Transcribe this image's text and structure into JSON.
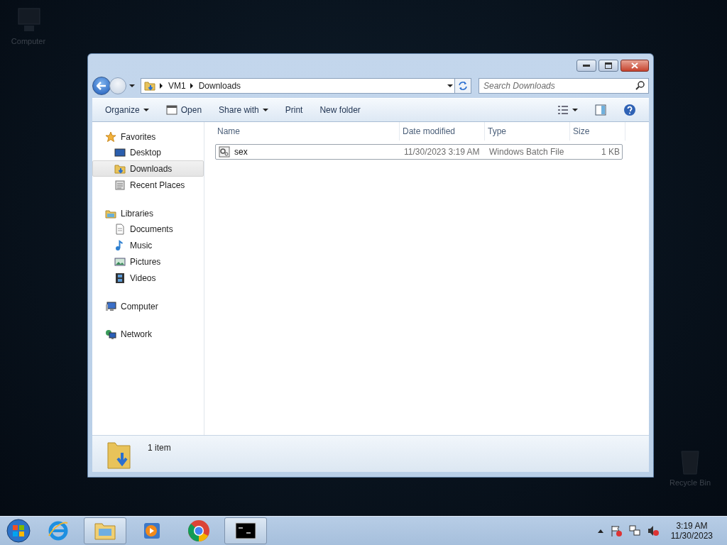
{
  "desktop": {
    "icons": [
      {
        "label": "Computer"
      },
      {
        "label": "Recycle Bin"
      }
    ]
  },
  "window": {
    "address": {
      "path": [
        "VM1",
        "Downloads"
      ]
    },
    "search": {
      "placeholder": "Search Downloads"
    },
    "toolbar": [
      {
        "label": "Organize",
        "kind": "menu"
      },
      {
        "label": "Open",
        "kind": "icon"
      },
      {
        "label": "Share with",
        "kind": "menu"
      },
      {
        "label": "Print",
        "kind": "plain"
      },
      {
        "label": "New folder",
        "kind": "plain"
      }
    ],
    "sidebar": [
      {
        "label": "Favorites",
        "items": [
          {
            "label": "Desktop",
            "selected": false
          },
          {
            "label": "Downloads",
            "selected": true
          },
          {
            "label": "Recent Places",
            "selected": false
          }
        ]
      },
      {
        "label": "Libraries",
        "items": [
          {
            "label": "Documents",
            "selected": false
          },
          {
            "label": "Music",
            "selected": false
          },
          {
            "label": "Pictures",
            "selected": false
          },
          {
            "label": "Videos",
            "selected": false
          }
        ]
      },
      {
        "label": "Computer"
      },
      {
        "label": "Network"
      }
    ],
    "table": {
      "columns": [
        "Name",
        "Date modified",
        "Type",
        "Size"
      ],
      "rows": [
        {
          "name": "sex",
          "date": "11/30/2023 3:19 AM",
          "type": "Windows Batch File",
          "size": "1 KB",
          "selected": true
        }
      ]
    },
    "details": {
      "count": "1 item"
    }
  },
  "taskbar": {
    "apps": [
      {
        "open": false
      },
      {
        "open": true
      },
      {
        "open": false
      },
      {
        "open": false
      },
      {
        "open": true
      }
    ],
    "time": "3:19 AM",
    "date": "11/30/2023"
  }
}
